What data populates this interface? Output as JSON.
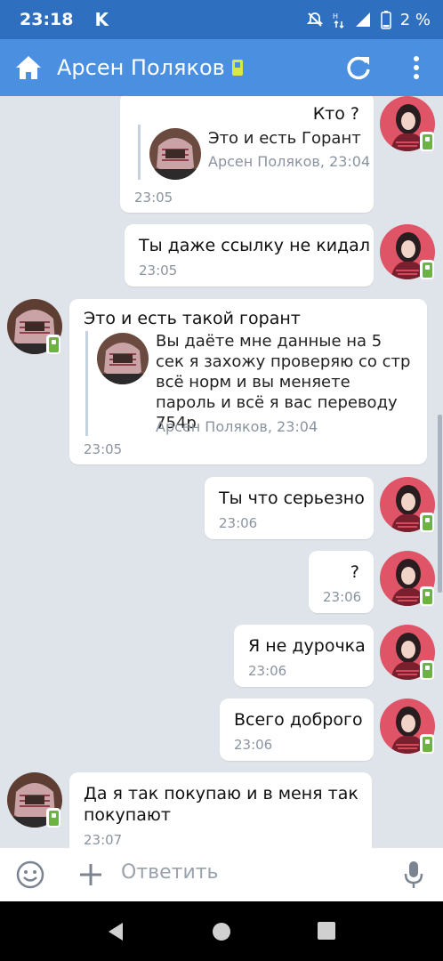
{
  "status_bar": {
    "time": "23:18",
    "app_icon": "K",
    "battery_percent": "2 %",
    "icons": [
      "mute-icon",
      "network-icon",
      "signal-icon",
      "battery-icon"
    ]
  },
  "header": {
    "title": "Арсен Поляков",
    "icons": [
      "home-icon",
      "mobile-badge-icon",
      "refresh-icon",
      "more-vert-icon"
    ]
  },
  "messages": [
    {
      "side": "out",
      "text": "Кто ?",
      "quote": {
        "text": "Это и есть Горант",
        "author_time": "Арсен Поляков, 23:04"
      },
      "time": "23:05"
    },
    {
      "side": "out",
      "text": "Ты даже ссылку не кидал",
      "time": "23:05"
    },
    {
      "side": "in",
      "text": "Это и есть такой горант",
      "quote": {
        "text": "Вы даёте мне данные на 5 сек я захожу проверяю со стр всё норм и вы меняете пароль и всё я вас переводу 754р",
        "author_time": "Арсен Поляков, 23:04"
      },
      "time": "23:05"
    },
    {
      "side": "out",
      "text": "Ты что серьезно",
      "time": "23:06"
    },
    {
      "side": "out",
      "text": "?",
      "time": "23:06"
    },
    {
      "side": "out",
      "text": "Я не дурочка",
      "time": "23:06"
    },
    {
      "side": "out",
      "text": "Всего доброго",
      "time": "23:06"
    },
    {
      "side": "in",
      "text": "Да я так покупаю и в меня так покупают",
      "time": "23:07"
    }
  ],
  "input": {
    "placeholder": "Ответить",
    "icons": [
      "emoji-icon",
      "plus-icon",
      "mic-icon"
    ]
  },
  "nav": {
    "icons": [
      "back-icon",
      "home-circle-icon",
      "recents-icon"
    ]
  },
  "colors": {
    "status_bar": "#2f6fc0",
    "app_bar": "#4a8fe0",
    "chat_bg": "#dfe4ea",
    "badge_green": "#6cb33f"
  }
}
